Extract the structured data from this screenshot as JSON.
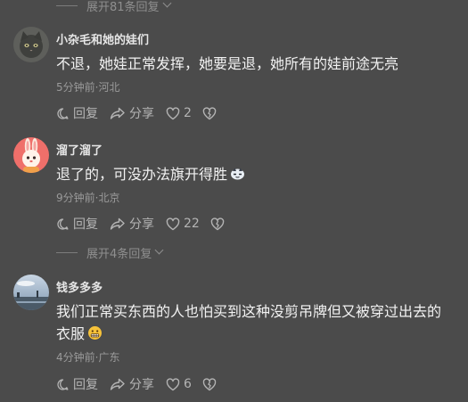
{
  "top_expand": {
    "label": "展开81条回复"
  },
  "comments": [
    {
      "username": "小杂毛和她的娃们",
      "text": "不退，她娃正常发挥，她要是退，她所有的娃前途无亮",
      "meta": "5分钟前·河北",
      "actions": {
        "reply": "回复",
        "share": "分享",
        "likes": "2"
      }
    },
    {
      "username": "溜了溜了",
      "text": "退了的，可没办法旗开得胜",
      "emoji": "smirk-face-emoji",
      "meta": "9分钟前·北京",
      "actions": {
        "reply": "回复",
        "share": "分享",
        "likes": "22"
      }
    },
    {
      "username": "钱多多多",
      "text_line1": "我们正常买东西的人也怕买到这种没剪吊牌但又被穿过出去的",
      "text_line2": "衣服",
      "emoji": "grimace-face-emoji",
      "meta": "4分钟前·广东",
      "actions": {
        "reply": "回复",
        "share": "分享",
        "likes": "6"
      }
    }
  ],
  "mid_expand": {
    "label": "展开4条回复"
  },
  "colors": {
    "background": "#4b4b4b",
    "text": "#f2f2f2",
    "secondary": "#9a9a9a"
  }
}
